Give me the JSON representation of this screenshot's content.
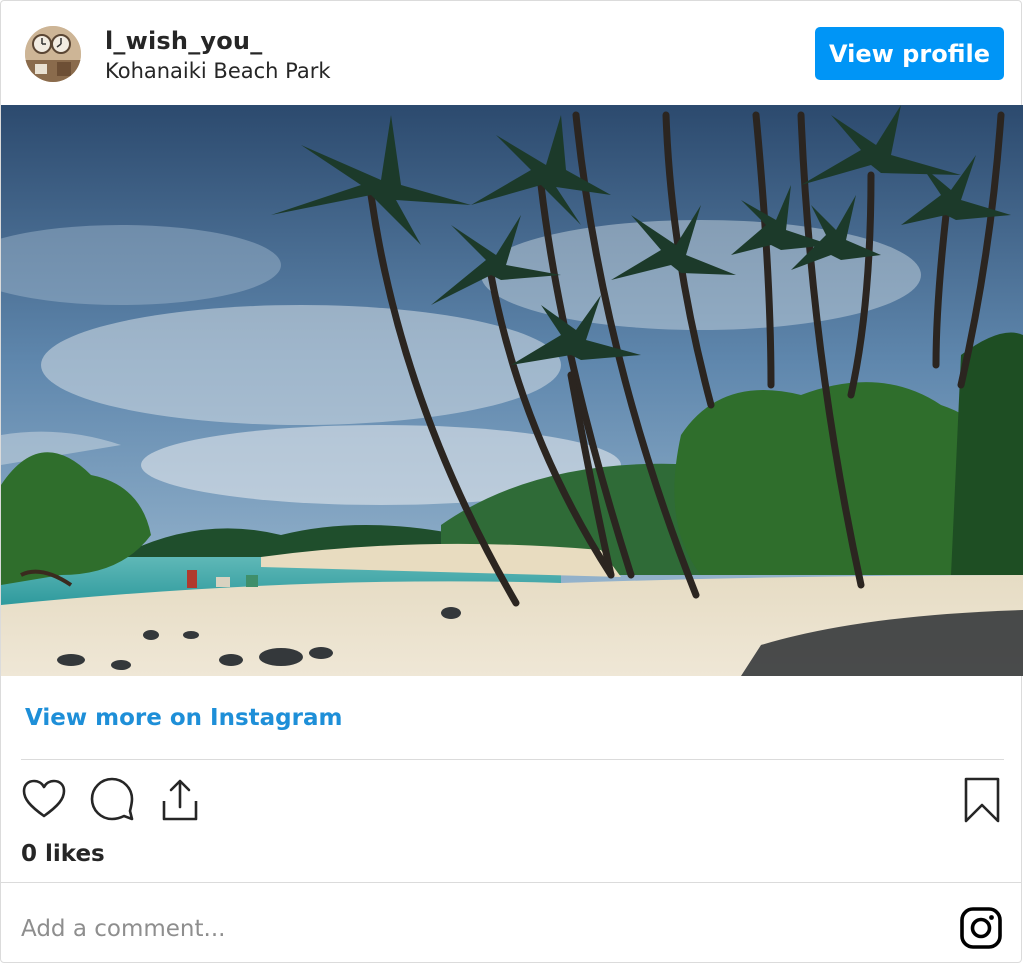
{
  "header": {
    "username": "l_wish_you_",
    "location": "Kohanaiki Beach Park",
    "view_profile_label": "View profile"
  },
  "post": {
    "image_alt": "Palm trees on a sandy beach beside turquoise water under a cloudy sky",
    "view_more_label": "View more on Instagram",
    "likes_text": "0 likes"
  },
  "comment": {
    "placeholder": "Add a comment..."
  },
  "icons": {
    "like": "heart-icon",
    "comment": "comment-icon",
    "share": "share-icon",
    "save": "bookmark-icon",
    "brand": "instagram-icon"
  },
  "colors": {
    "accent": "#0095f6",
    "link": "#1e8fd8",
    "text": "#262626",
    "muted": "#8e8e8e",
    "border": "#dbdbdb"
  }
}
